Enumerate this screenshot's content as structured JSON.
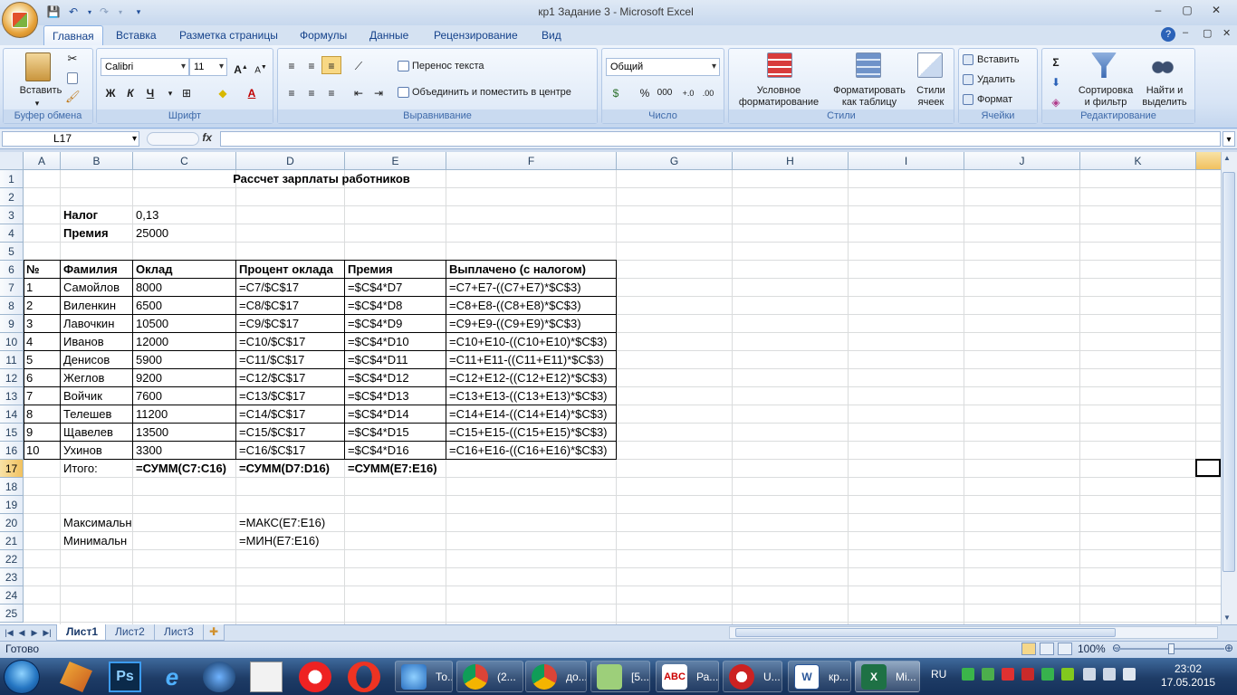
{
  "window": {
    "title": "кр1 Задание 3 - Microsoft Excel",
    "minimize": "–",
    "restore": "▢",
    "close": "✕"
  },
  "ribbon_tabs": [
    {
      "label": "Главная",
      "active": true
    },
    {
      "label": "Вставка"
    },
    {
      "label": "Разметка страницы"
    },
    {
      "label": "Формулы"
    },
    {
      "label": "Данные"
    },
    {
      "label": "Рецензирование"
    },
    {
      "label": "Вид"
    }
  ],
  "ribbon": {
    "clipboard": {
      "label": "Буфер обмена",
      "paste": "Вставить"
    },
    "font": {
      "label": "Шрифт",
      "font_name": "Calibri",
      "font_size": "11",
      "bold": "Ж",
      "italic": "К",
      "underline": "Ч"
    },
    "alignment": {
      "label": "Выравнивание",
      "wrap": "Перенос текста",
      "merge": "Объединить и поместить в центре"
    },
    "number": {
      "label": "Число",
      "format": "Общий",
      "percent": "%",
      "thousands": "000"
    },
    "styles": {
      "label": "Стили",
      "conditional": "Условное\nформатирование",
      "as_table": "Форматировать\nкак таблицу",
      "cell_styles": "Стили\nячеек"
    },
    "cells": {
      "label": "Ячейки",
      "insert": "Вставить",
      "delete": "Удалить",
      "format": "Формат"
    },
    "editing": {
      "label": "Редактирование",
      "sum": "Σ",
      "sort": "Сортировка\nи фильтр",
      "find": "Найти и\nвыделить"
    }
  },
  "formula_bar": {
    "name_box": "L17",
    "fx": "fx",
    "value": ""
  },
  "columns": [
    "A",
    "B",
    "C",
    "D",
    "E",
    "F",
    "G",
    "H",
    "I",
    "J",
    "K"
  ],
  "rows": [
    "1",
    "2",
    "3",
    "4",
    "5",
    "6",
    "7",
    "8",
    "9",
    "10",
    "11",
    "12",
    "13",
    "14",
    "15",
    "16",
    "17",
    "18",
    "19",
    "20",
    "21",
    "22",
    "23",
    "24",
    "25"
  ],
  "sheet": {
    "title": "Рассчет зарплаты работников",
    "tax_label": "Налог",
    "tax_value": "0,13",
    "bonus_label": "Премия",
    "bonus_value": "25000",
    "headers": [
      "№",
      "Фамилия",
      "Оклад",
      "Процент оклада",
      "Премия",
      "Выплачено (с налогом)"
    ],
    "table_rows": [
      [
        "1",
        "Самойлов",
        "8000",
        "=C7/$C$17",
        "=$C$4*D7",
        "=C7+E7-((C7+E7)*$C$3)"
      ],
      [
        "2",
        "Виленкин",
        "6500",
        "=C8/$C$17",
        "=$C$4*D8",
        "=C8+E8-((C8+E8)*$C$3)"
      ],
      [
        "3",
        "Лавочкин",
        "10500",
        "=C9/$C$17",
        "=$C$4*D9",
        "=C9+E9-((C9+E9)*$C$3)"
      ],
      [
        "4",
        "Иванов",
        "12000",
        "=C10/$C$17",
        "=$C$4*D10",
        "=C10+E10-((C10+E10)*$C$3)"
      ],
      [
        "5",
        "Денисов",
        "5900",
        "=C11/$C$17",
        "=$C$4*D11",
        "=C11+E11-((C11+E11)*$C$3)"
      ],
      [
        "6",
        "Жеглов",
        "9200",
        "=C12/$C$17",
        "=$C$4*D12",
        "=C12+E12-((C12+E12)*$C$3)"
      ],
      [
        "7",
        "Войчик",
        "7600",
        "=C13/$C$17",
        "=$C$4*D13",
        "=C13+E13-((C13+E13)*$C$3)"
      ],
      [
        "8",
        "Телешев",
        "11200",
        "=C14/$C$17",
        "=$C$4*D14",
        "=C14+E14-((C14+E14)*$C$3)"
      ],
      [
        "9",
        "Щавелев",
        "13500",
        "=C15/$C$17",
        "=$C$4*D15",
        "=C15+E15-((C15+E15)*$C$3)"
      ],
      [
        "10",
        "Ухинов",
        "3300",
        "=C16/$C$17",
        "=$C$4*D16",
        "=C16+E16-((C16+E16)*$C$3)"
      ]
    ],
    "total_label": "Итого:",
    "total_c": "=СУММ(C7:C16)",
    "total_d": "=СУММ(D7:D16)",
    "total_e": "=СУММ(E7:E16)",
    "max_label": "Максимальн",
    "max_formula": "=МАКС(E7:E16)",
    "min_label": "Минимальн",
    "min_formula": "=МИН(E7:E16)"
  },
  "sheet_tabs": [
    "Лист1",
    "Лист2",
    "Лист3"
  ],
  "status": {
    "text": "Готово",
    "zoom": "100%"
  },
  "taskbar": {
    "items": [
      "То...",
      "(2...",
      "до...",
      "[5...",
      "Ра...",
      "U...",
      "кр...",
      "Mi..."
    ],
    "lang": "RU",
    "time": "23:02",
    "date": "17.05.2015"
  },
  "colors": {
    "accent": "#15428b",
    "selection": "#f1c15f",
    "taskbar": "#1e3c66"
  }
}
